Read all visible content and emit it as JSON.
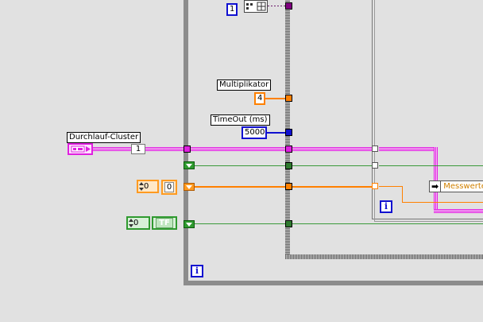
{
  "diagram": {
    "loop_iteration_outer": "i",
    "loop_iteration_inner": "i",
    "top_constant": "1",
    "top_icon": "cluster-grid-icon"
  },
  "labels": {
    "multiplikator": "Multiplikator",
    "timeout": "TimeOut (ms)",
    "durchlauf_cluster": "Durchlauf-Cluster"
  },
  "constants": {
    "multiplikator_value": "4",
    "timeout_value": "5000",
    "cluster_index": "1",
    "orange_control_value": "0",
    "orange_indicator_value": "0",
    "green_control_value": "0",
    "green_indicator_value": "TF"
  },
  "right_node": {
    "label": "Messwerte"
  },
  "colors": {
    "wire_green": "#3a9a3a",
    "wire_orange": "#ff8000",
    "wire_blue": "#1010d0",
    "wire_pink": "#e020e0",
    "background": "#e1e1e1"
  }
}
